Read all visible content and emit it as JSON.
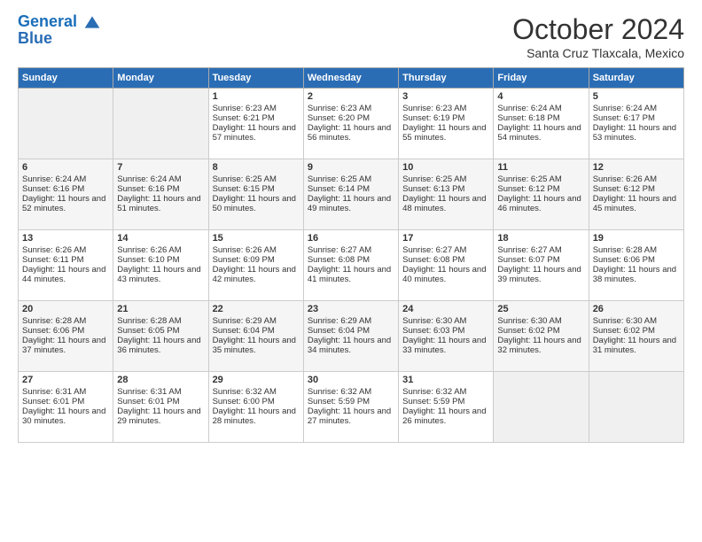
{
  "header": {
    "logo_line1": "General",
    "logo_line2": "Blue",
    "month": "October 2024",
    "location": "Santa Cruz Tlaxcala, Mexico"
  },
  "weekdays": [
    "Sunday",
    "Monday",
    "Tuesday",
    "Wednesday",
    "Thursday",
    "Friday",
    "Saturday"
  ],
  "weeks": [
    [
      {
        "day": "",
        "info": ""
      },
      {
        "day": "",
        "info": ""
      },
      {
        "day": "1",
        "info": "Sunrise: 6:23 AM\nSunset: 6:21 PM\nDaylight: 11 hours and 57 minutes."
      },
      {
        "day": "2",
        "info": "Sunrise: 6:23 AM\nSunset: 6:20 PM\nDaylight: 11 hours and 56 minutes."
      },
      {
        "day": "3",
        "info": "Sunrise: 6:23 AM\nSunset: 6:19 PM\nDaylight: 11 hours and 55 minutes."
      },
      {
        "day": "4",
        "info": "Sunrise: 6:24 AM\nSunset: 6:18 PM\nDaylight: 11 hours and 54 minutes."
      },
      {
        "day": "5",
        "info": "Sunrise: 6:24 AM\nSunset: 6:17 PM\nDaylight: 11 hours and 53 minutes."
      }
    ],
    [
      {
        "day": "6",
        "info": "Sunrise: 6:24 AM\nSunset: 6:16 PM\nDaylight: 11 hours and 52 minutes."
      },
      {
        "day": "7",
        "info": "Sunrise: 6:24 AM\nSunset: 6:16 PM\nDaylight: 11 hours and 51 minutes."
      },
      {
        "day": "8",
        "info": "Sunrise: 6:25 AM\nSunset: 6:15 PM\nDaylight: 11 hours and 50 minutes."
      },
      {
        "day": "9",
        "info": "Sunrise: 6:25 AM\nSunset: 6:14 PM\nDaylight: 11 hours and 49 minutes."
      },
      {
        "day": "10",
        "info": "Sunrise: 6:25 AM\nSunset: 6:13 PM\nDaylight: 11 hours and 48 minutes."
      },
      {
        "day": "11",
        "info": "Sunrise: 6:25 AM\nSunset: 6:12 PM\nDaylight: 11 hours and 46 minutes."
      },
      {
        "day": "12",
        "info": "Sunrise: 6:26 AM\nSunset: 6:12 PM\nDaylight: 11 hours and 45 minutes."
      }
    ],
    [
      {
        "day": "13",
        "info": "Sunrise: 6:26 AM\nSunset: 6:11 PM\nDaylight: 11 hours and 44 minutes."
      },
      {
        "day": "14",
        "info": "Sunrise: 6:26 AM\nSunset: 6:10 PM\nDaylight: 11 hours and 43 minutes."
      },
      {
        "day": "15",
        "info": "Sunrise: 6:26 AM\nSunset: 6:09 PM\nDaylight: 11 hours and 42 minutes."
      },
      {
        "day": "16",
        "info": "Sunrise: 6:27 AM\nSunset: 6:08 PM\nDaylight: 11 hours and 41 minutes."
      },
      {
        "day": "17",
        "info": "Sunrise: 6:27 AM\nSunset: 6:08 PM\nDaylight: 11 hours and 40 minutes."
      },
      {
        "day": "18",
        "info": "Sunrise: 6:27 AM\nSunset: 6:07 PM\nDaylight: 11 hours and 39 minutes."
      },
      {
        "day": "19",
        "info": "Sunrise: 6:28 AM\nSunset: 6:06 PM\nDaylight: 11 hours and 38 minutes."
      }
    ],
    [
      {
        "day": "20",
        "info": "Sunrise: 6:28 AM\nSunset: 6:06 PM\nDaylight: 11 hours and 37 minutes."
      },
      {
        "day": "21",
        "info": "Sunrise: 6:28 AM\nSunset: 6:05 PM\nDaylight: 11 hours and 36 minutes."
      },
      {
        "day": "22",
        "info": "Sunrise: 6:29 AM\nSunset: 6:04 PM\nDaylight: 11 hours and 35 minutes."
      },
      {
        "day": "23",
        "info": "Sunrise: 6:29 AM\nSunset: 6:04 PM\nDaylight: 11 hours and 34 minutes."
      },
      {
        "day": "24",
        "info": "Sunrise: 6:30 AM\nSunset: 6:03 PM\nDaylight: 11 hours and 33 minutes."
      },
      {
        "day": "25",
        "info": "Sunrise: 6:30 AM\nSunset: 6:02 PM\nDaylight: 11 hours and 32 minutes."
      },
      {
        "day": "26",
        "info": "Sunrise: 6:30 AM\nSunset: 6:02 PM\nDaylight: 11 hours and 31 minutes."
      }
    ],
    [
      {
        "day": "27",
        "info": "Sunrise: 6:31 AM\nSunset: 6:01 PM\nDaylight: 11 hours and 30 minutes."
      },
      {
        "day": "28",
        "info": "Sunrise: 6:31 AM\nSunset: 6:01 PM\nDaylight: 11 hours and 29 minutes."
      },
      {
        "day": "29",
        "info": "Sunrise: 6:32 AM\nSunset: 6:00 PM\nDaylight: 11 hours and 28 minutes."
      },
      {
        "day": "30",
        "info": "Sunrise: 6:32 AM\nSunset: 5:59 PM\nDaylight: 11 hours and 27 minutes."
      },
      {
        "day": "31",
        "info": "Sunrise: 6:32 AM\nSunset: 5:59 PM\nDaylight: 11 hours and 26 minutes."
      },
      {
        "day": "",
        "info": ""
      },
      {
        "day": "",
        "info": ""
      }
    ]
  ]
}
